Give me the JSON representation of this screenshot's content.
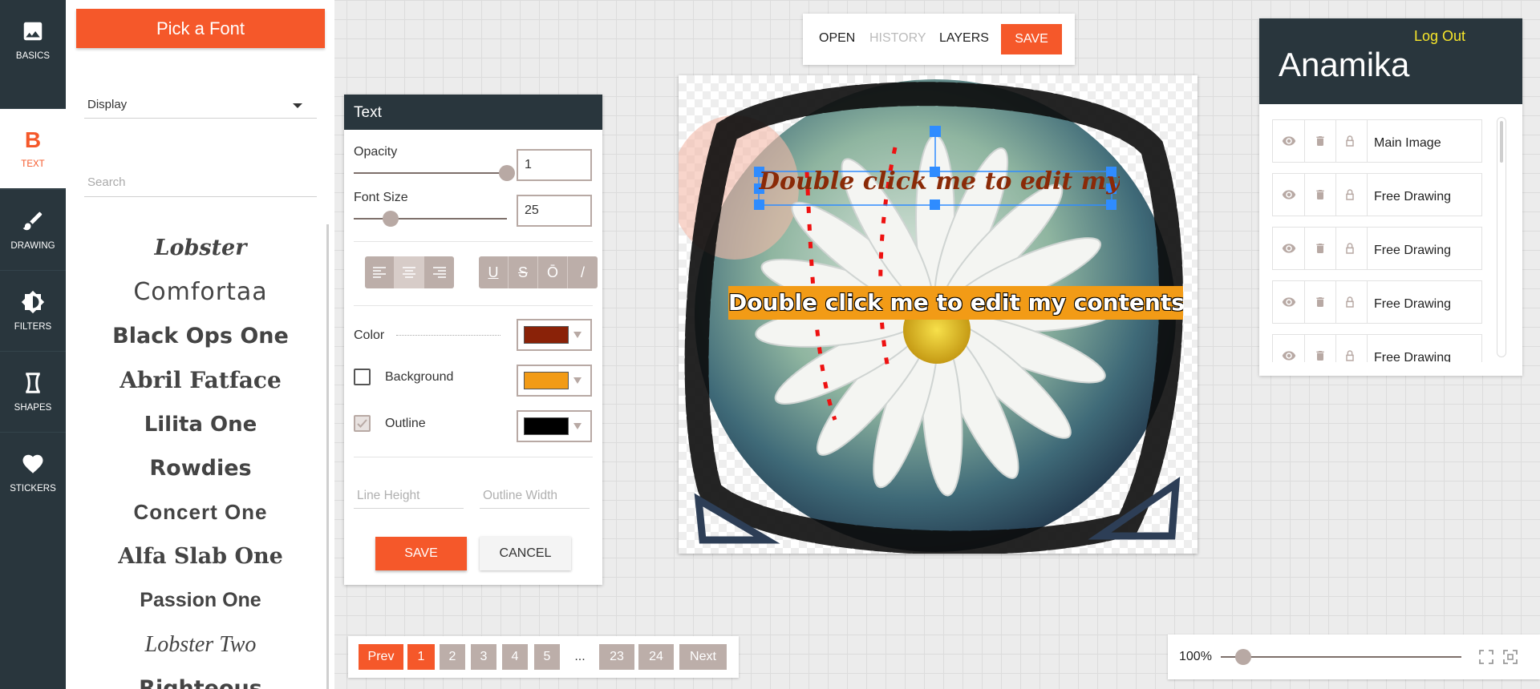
{
  "nav": {
    "items": [
      {
        "label": "BASICS",
        "icon": "image-icon"
      },
      {
        "label": "TEXT",
        "icon": "text-b-icon",
        "glyph": "B"
      },
      {
        "label": "DRAWING",
        "icon": "brush-icon"
      },
      {
        "label": "FILTERS",
        "icon": "filter-icon"
      },
      {
        "label": "SHAPES",
        "icon": "shape-icon"
      },
      {
        "label": "STICKERS",
        "icon": "heart-icon"
      }
    ]
  },
  "font_panel": {
    "title": "Pick a Font",
    "category": "Display",
    "search_placeholder": "Search",
    "fonts": [
      "Lobster",
      "Comfortaa",
      "Black Ops One",
      "Abril Fatface",
      "Lilita One",
      "Rowdies",
      "Concert One",
      "Alfa Slab One",
      "Passion One",
      "Lobster Two",
      "Righteous"
    ]
  },
  "text_panel": {
    "title": "Text",
    "opacity_label": "Opacity",
    "opacity_value": "1",
    "font_size_label": "Font Size",
    "font_size_value": "25",
    "align_buttons": [
      "align-left",
      "align-center",
      "align-right"
    ],
    "style_buttons": [
      "U",
      "S",
      "Ō",
      "/"
    ],
    "color_label": "Color",
    "background_label": "Background",
    "outline_label": "Outline",
    "line_height_placeholder": "Line Height",
    "outline_width_placeholder": "Outline Width",
    "save_label": "SAVE",
    "cancel_label": "CANCEL",
    "colors": {
      "text": "#8a2208",
      "background": "#f29b16",
      "outline": "#000000"
    }
  },
  "top_menu": {
    "open": "OPEN",
    "history": "HISTORY",
    "layers": "LAYERS",
    "save": "SAVE"
  },
  "canvas": {
    "text1": "Double click me to edit my contents.",
    "text2": "Double click me to edit my contents."
  },
  "pagination": {
    "prev": "Prev",
    "pages": [
      "1",
      "2",
      "3",
      "4",
      "5"
    ],
    "ellipsis": "...",
    "last_pages": [
      "23",
      "24"
    ],
    "next": "Next",
    "current": "1"
  },
  "zoom": {
    "label": "100%"
  },
  "user": {
    "logout": "Log Out",
    "name": "Anamika",
    "layers": [
      "Main Image",
      "Free Drawing",
      "Free Drawing",
      "Free Drawing",
      "Free Drawing"
    ]
  },
  "accent_color": "#f5582a"
}
